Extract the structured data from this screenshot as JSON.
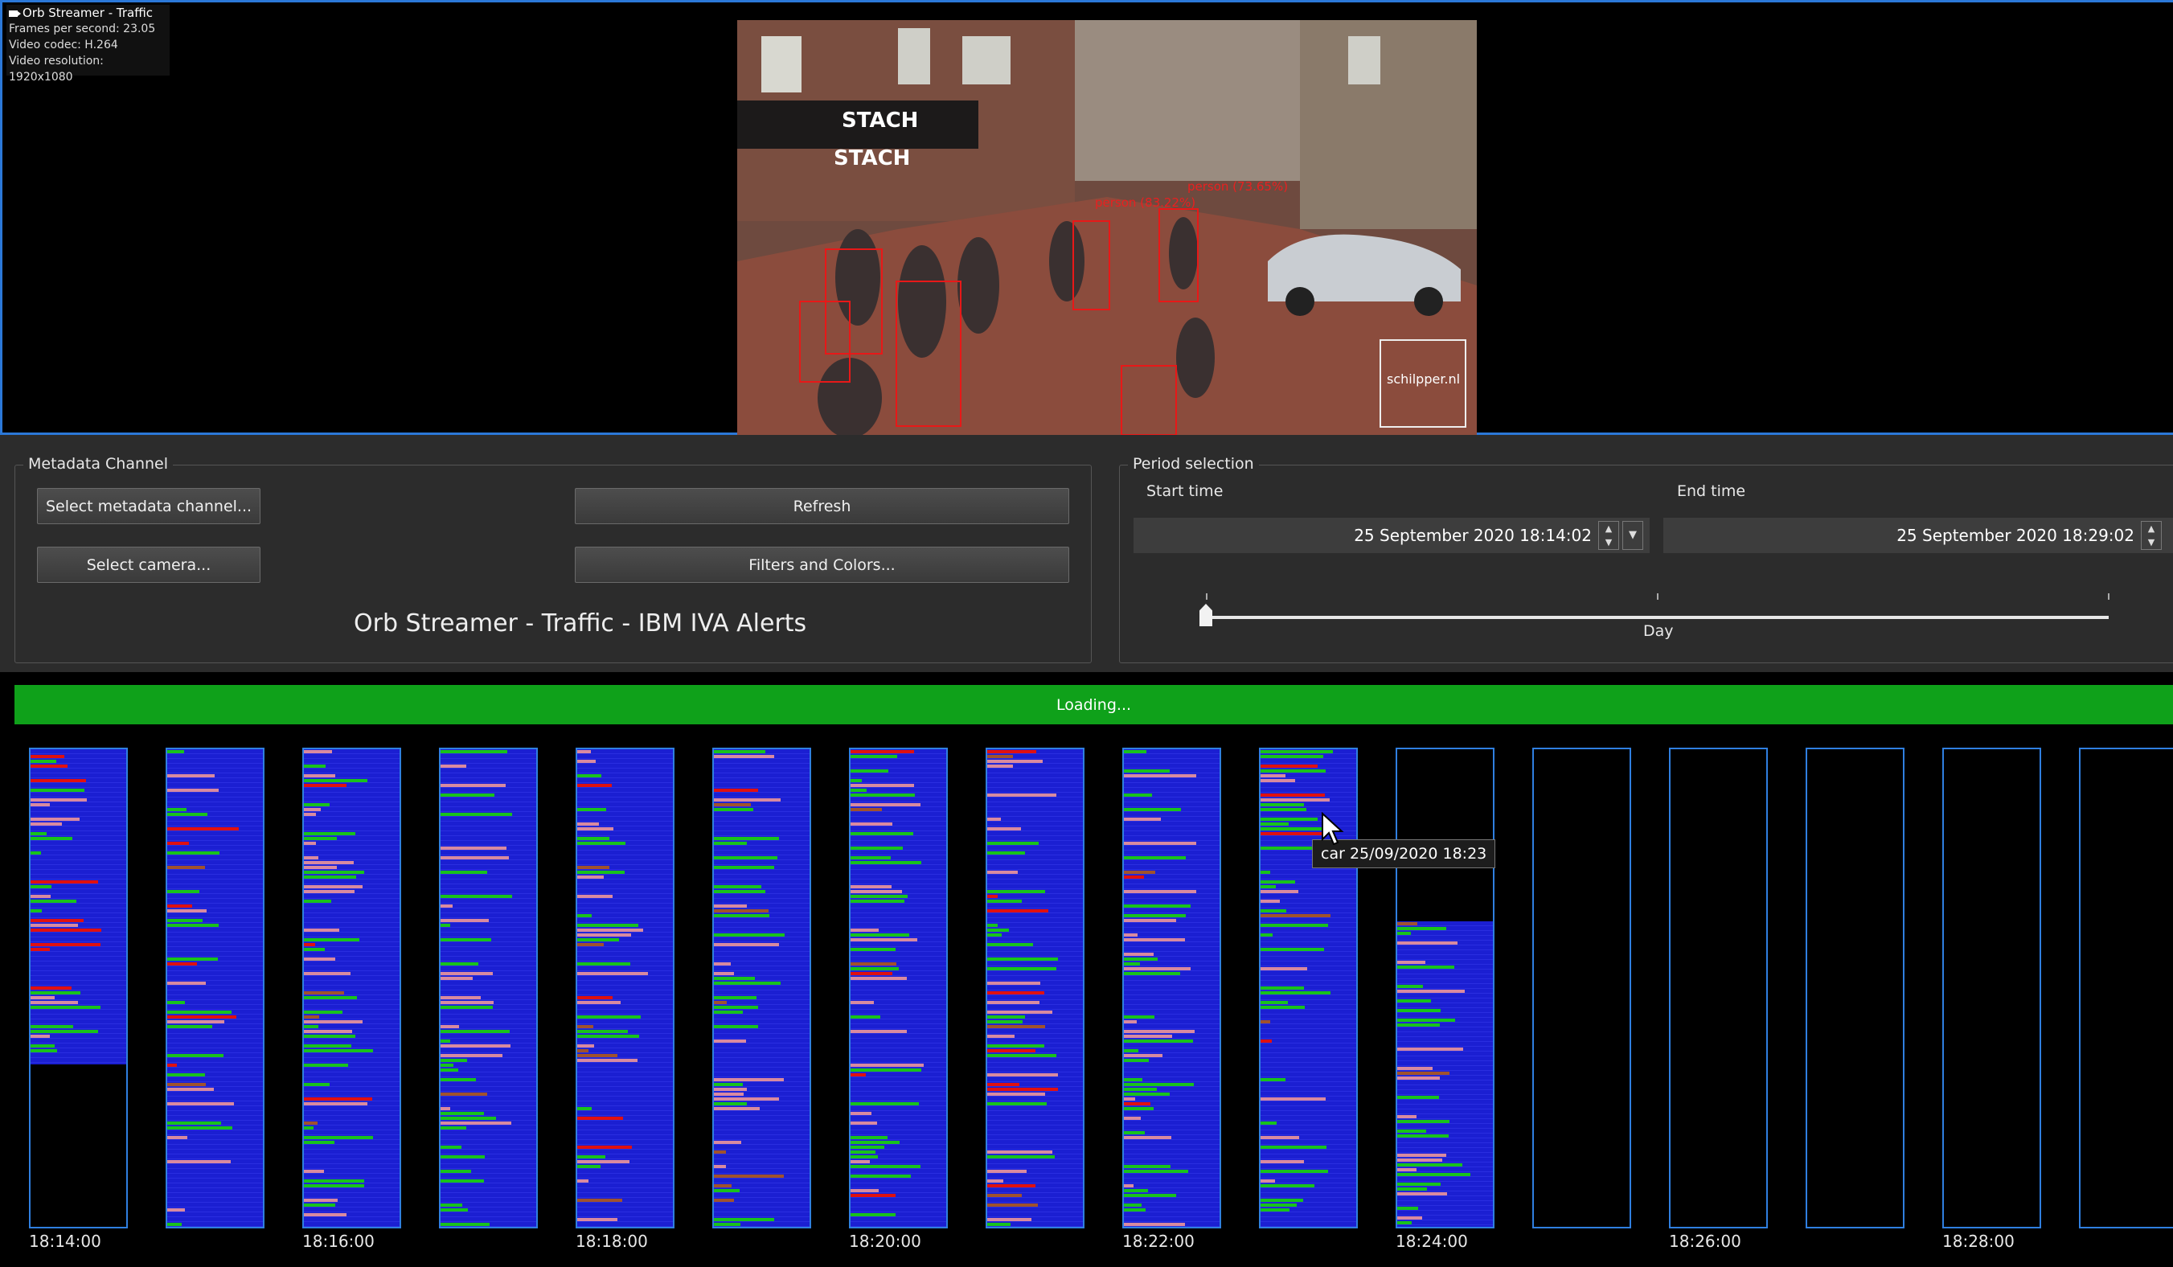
{
  "stream_info": {
    "window_title": "Orb Streamer - Traffic",
    "fps": "Frames per second: 23.05",
    "codec": "Video codec: H.264",
    "resolution": "Video resolution: 1920x1080"
  },
  "video": {
    "store_signs": [
      "STACH",
      "STACH"
    ],
    "detections": [
      "person (73.65%)",
      "person (83.22%)"
    ],
    "watermark": "schilpper.nl"
  },
  "metadata_channel": {
    "legend": "Metadata Channel",
    "select_channel_label": "Select metadata channel...",
    "select_camera_label": "Select camera...",
    "refresh_label": "Refresh",
    "filters_label": "Filters and Colors...",
    "caption": "Orb Streamer - Traffic - IBM IVA Alerts"
  },
  "period": {
    "legend": "Period selection",
    "start_label": "Start time",
    "end_label": "End time",
    "start_value": "25 September 2020 18:14:02",
    "end_value": "25 September 2020 18:29:02",
    "slider_label": "Day",
    "slider_level": 0
  },
  "progress": {
    "label": "Loading...",
    "fraction": 1.0
  },
  "timeline": {
    "colors": {
      "bar": "#1b1fd2",
      "green": "#18c21c",
      "pink": "#d88aa0",
      "red": "#e01010",
      "brown": "#a0522d",
      "border": "#2f7fe0"
    },
    "columns": [
      {
        "fill": 0.66,
        "seed": 3
      },
      {
        "fill": 1.0,
        "seed": 7
      },
      {
        "fill": 1.0,
        "seed": 11
      },
      {
        "fill": 1.0,
        "seed": 13
      },
      {
        "fill": 1.0,
        "seed": 17
      },
      {
        "fill": 1.0,
        "seed": 19
      },
      {
        "fill": 1.0,
        "seed": 23
      },
      {
        "fill": 1.0,
        "seed": 29
      },
      {
        "fill": 1.0,
        "seed": 31
      },
      {
        "fill": 1.0,
        "seed": 37
      },
      {
        "fill": 0.64,
        "seed": 41,
        "empty_top": true
      },
      {
        "fill": 0,
        "seed": 0
      },
      {
        "fill": 0,
        "seed": 0
      },
      {
        "fill": 0,
        "seed": 0
      },
      {
        "fill": 0,
        "seed": 0
      },
      {
        "fill": 0,
        "seed": 0
      }
    ],
    "time_labels": [
      "18:14:00",
      "18:16:00",
      "18:18:00",
      "18:20:00",
      "18:22:00",
      "18:24:00",
      "18:26:00",
      "18:28:00"
    ],
    "tooltip": "car 25/09/2020 18:23"
  }
}
